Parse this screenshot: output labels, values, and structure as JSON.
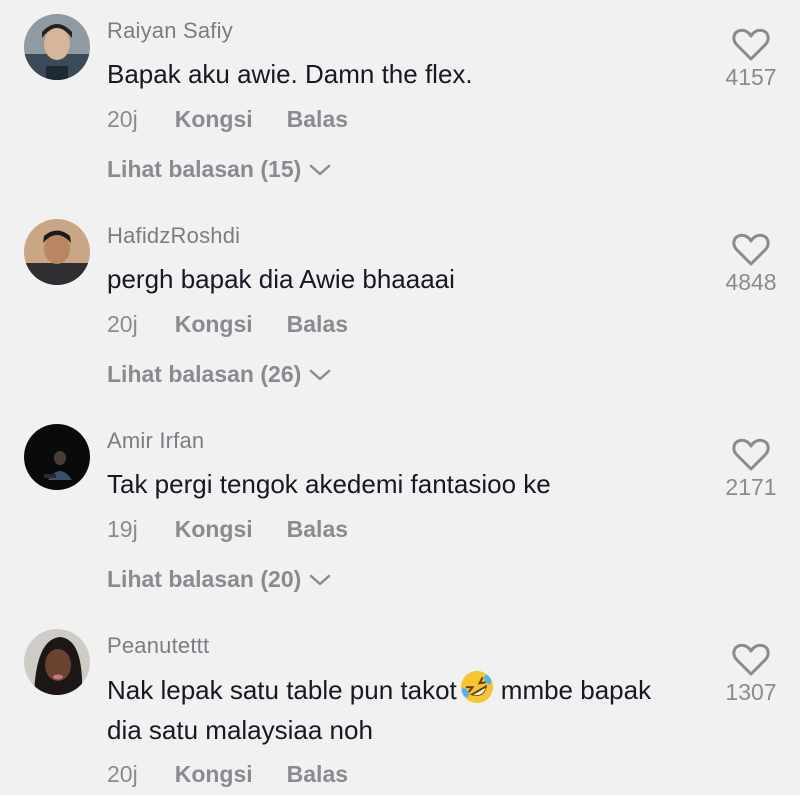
{
  "comments": [
    {
      "username": "Raiyan Safiy",
      "text": "Bapak aku awie. Damn the flex.",
      "time": "20j",
      "share_label": "Kongsi",
      "reply_label": "Balas",
      "view_replies": "Lihat balasan (15)",
      "likes": "4157"
    },
    {
      "username": "HafidzRoshdi",
      "text": "pergh bapak dia Awie bhaaaai",
      "time": "20j",
      "share_label": "Kongsi",
      "reply_label": "Balas",
      "view_replies": "Lihat balasan (26)",
      "likes": "4848"
    },
    {
      "username": "Amir Irfan",
      "text": "Tak pergi tengok akedemi fantasioo ke",
      "time": "19j",
      "share_label": "Kongsi",
      "reply_label": "Balas",
      "view_replies": "Lihat balasan (20)",
      "likes": "2171"
    },
    {
      "username": "Peanutettt",
      "text_before_emoji": "Nak lepak satu table pun takot",
      "text_after_emoji": "mmbe bapak dia satu malaysiaa noh",
      "emoji": "rolling-on-floor-laughing-emoji",
      "time": "20j",
      "share_label": "Kongsi",
      "reply_label": "Balas",
      "likes": "1307"
    }
  ],
  "colors": {
    "background": "#f1f1f2",
    "text": "#161823",
    "muted": "#8a8b91"
  }
}
